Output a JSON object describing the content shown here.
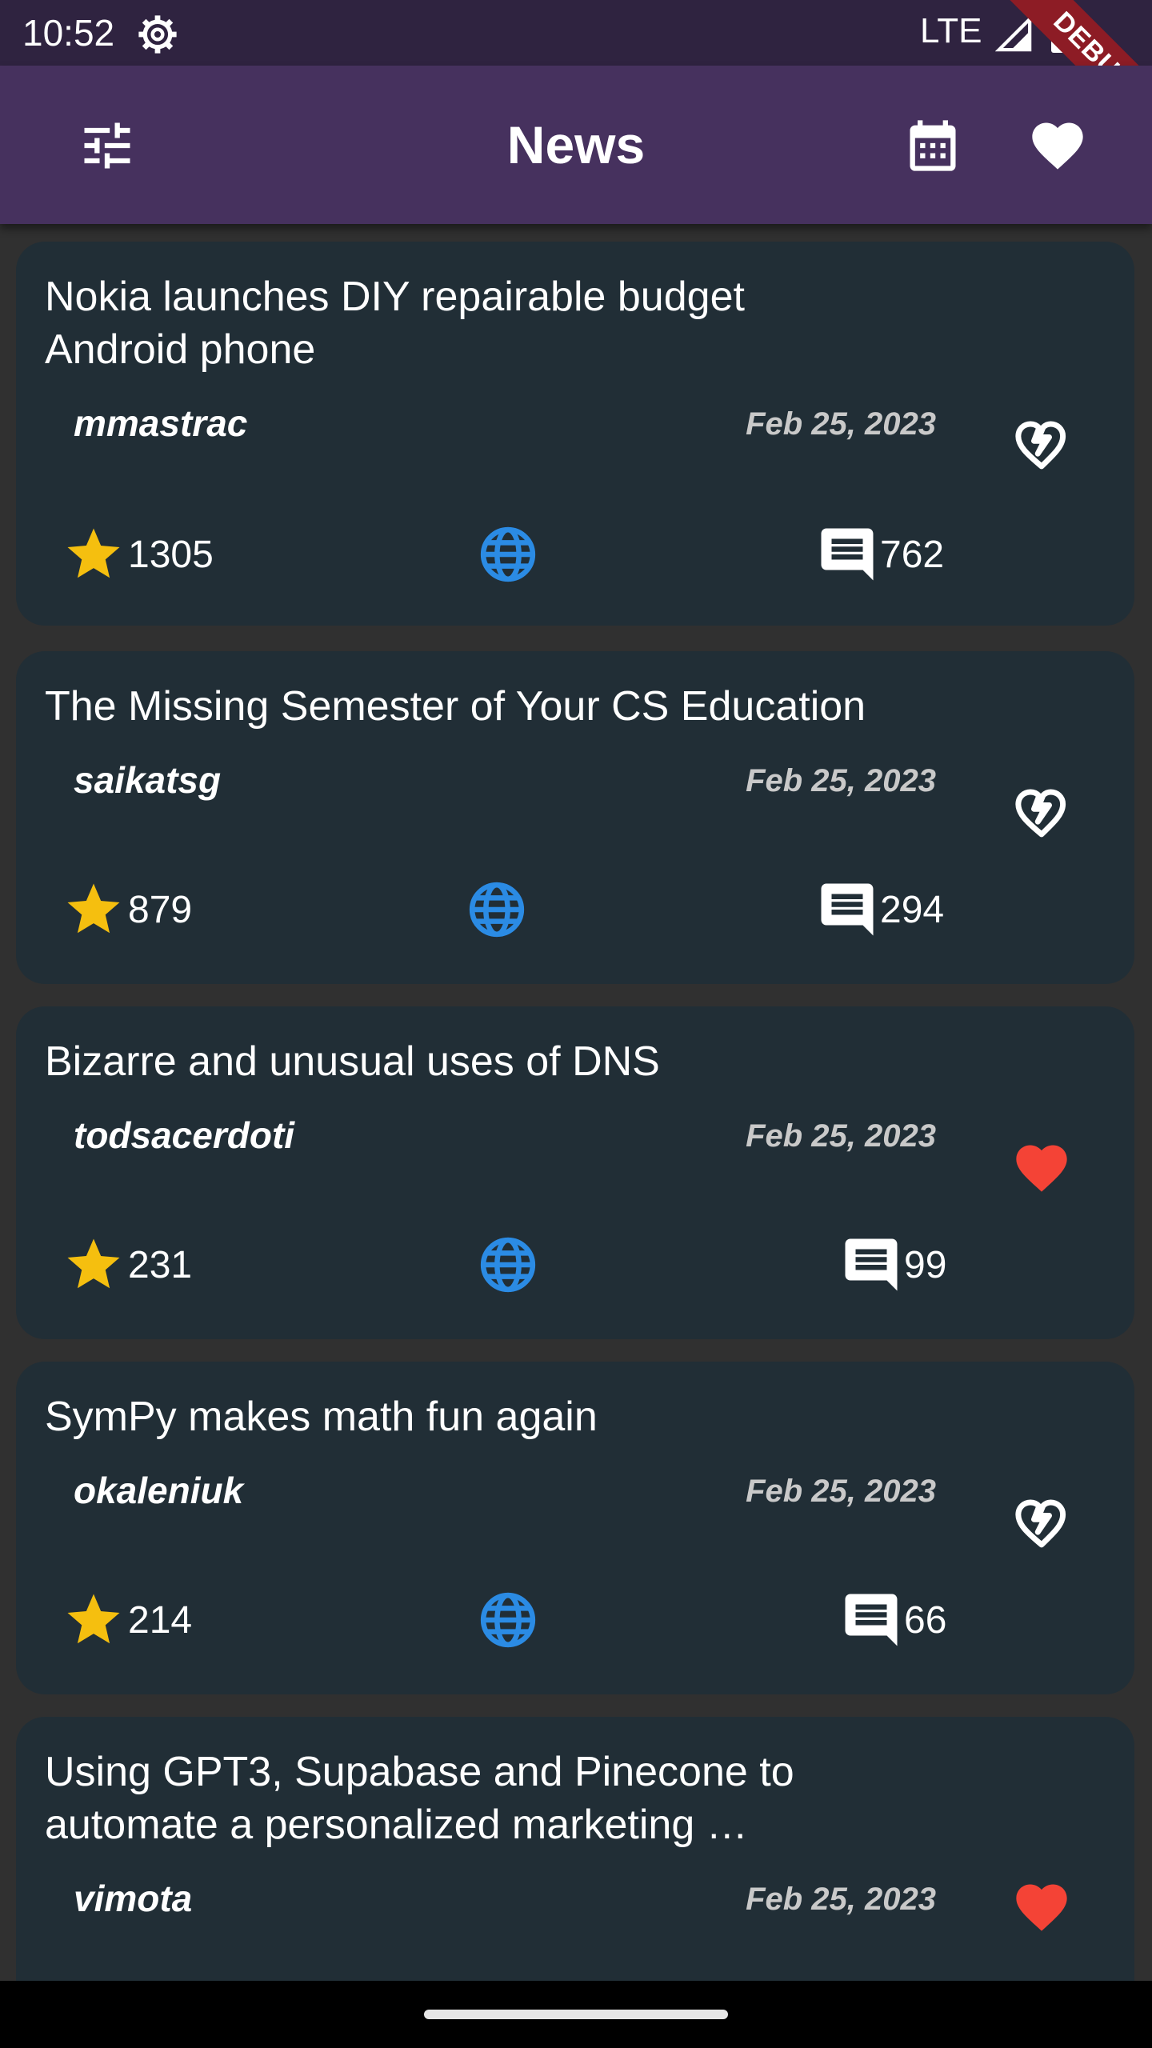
{
  "status_bar": {
    "time": "10:52",
    "network": "LTE",
    "debug_label": "DEBUG"
  },
  "app_bar": {
    "title": "News"
  },
  "colors": {
    "app_bar": "#46315e",
    "status_bar": "#2f2340",
    "card": "#212e36",
    "background": "#303030",
    "star": "#f5bf0f",
    "globe": "#2b8be4",
    "liked_heart": "#f44336"
  },
  "icons": {
    "filter": "tune-icon",
    "calendar": "calendar-icon",
    "favorites": "heart-icon",
    "score": "star-icon",
    "link": "globe-icon",
    "comments": "comment-icon",
    "liked": "heart-filled-icon",
    "not_liked": "heart-broken-icon"
  },
  "stories": [
    {
      "title": "Nokia launches DIY repairable budget Android phone",
      "author": "mmastrac",
      "date": "Feb 25, 2023",
      "score": "1305",
      "comments": "762",
      "liked": false
    },
    {
      "title": "The Missing Semester of Your CS Education",
      "author": "saikatsg",
      "date": "Feb 25, 2023",
      "score": "879",
      "comments": "294",
      "liked": false
    },
    {
      "title": "Bizarre and unusual uses of DNS",
      "author": "todsacerdoti",
      "date": "Feb 25, 2023",
      "score": "231",
      "comments": "99",
      "liked": true
    },
    {
      "title": "SymPy makes math fun again",
      "author": "okaleniuk",
      "date": "Feb 25, 2023",
      "score": "214",
      "comments": "66",
      "liked": false
    },
    {
      "title": "Using GPT3, Supabase and Pinecone to automate a personalized marketing …",
      "author": "vimota",
      "date": "Feb 25, 2023",
      "score": "",
      "comments": "",
      "liked": true
    }
  ]
}
